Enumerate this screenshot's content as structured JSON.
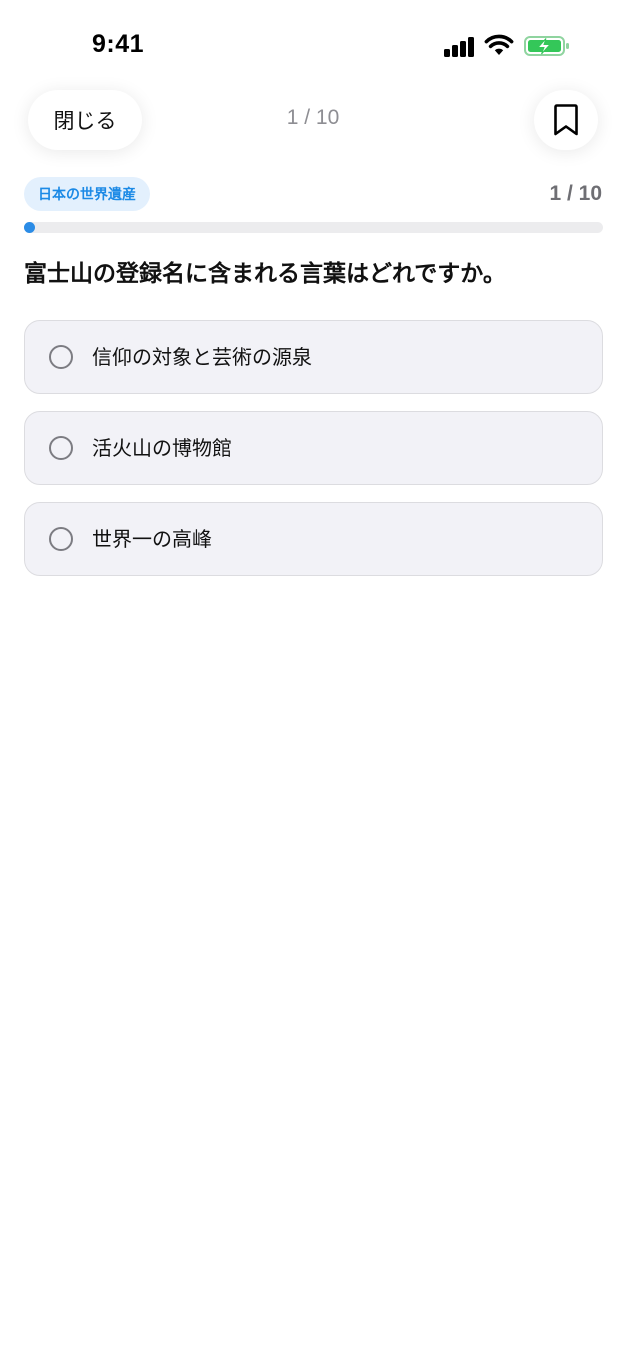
{
  "status_bar": {
    "time": "9:41",
    "icons": [
      "signal-icon",
      "wifi-icon",
      "battery-charging-icon"
    ],
    "battery_color": "#34c759"
  },
  "header": {
    "close_label": "閉じる",
    "progress_text": "1 / 10",
    "bookmark_icon": "bookmark-icon"
  },
  "quiz": {
    "category": "日本の世界遺産",
    "count_text": "1 / 10",
    "progress_fraction": 0.1,
    "question": "富士山の登録名に含まれる言葉はどれですか。",
    "options": [
      {
        "label": "信仰の対象と芸術の源泉"
      },
      {
        "label": "活火山の博物館"
      },
      {
        "label": "世界一の高峰"
      }
    ]
  },
  "colors": {
    "accent": "#2b8ce6",
    "badge_bg": "#e3f0fd",
    "badge_text": "#1c8ae6",
    "option_bg": "#f2f2f7"
  }
}
